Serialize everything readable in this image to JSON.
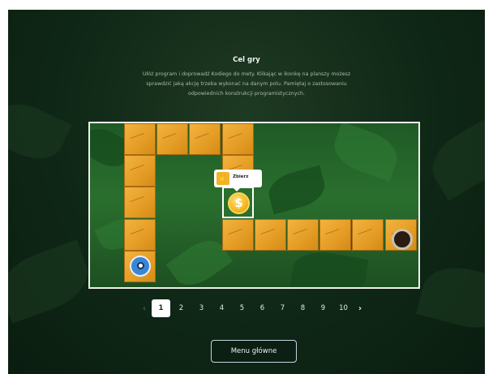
{
  "header": {
    "title": "Cel gry",
    "description": "Ułóż program i doprowadź Kodiego do mety. Klikając w ikonkę na planszy możesz sprawdzić jaką akcję trzeba wykonać na danym polu. Pamiętaj o zastosowaniu odpowiednich konstrukcji programistycznych."
  },
  "board": {
    "tooltip_label": "Zbierz",
    "coin_symbol": "$",
    "colors": {
      "tile": "#e8a22a",
      "frame": "#eef0ea",
      "background": "#2a6f2e"
    }
  },
  "pagination": {
    "prev_icon": "‹",
    "next_icon": "›",
    "pages": [
      "1",
      "2",
      "3",
      "4",
      "5",
      "6",
      "7",
      "8",
      "9",
      "10"
    ],
    "current": "1"
  },
  "footer": {
    "menu_button_label": "Menu główne"
  }
}
